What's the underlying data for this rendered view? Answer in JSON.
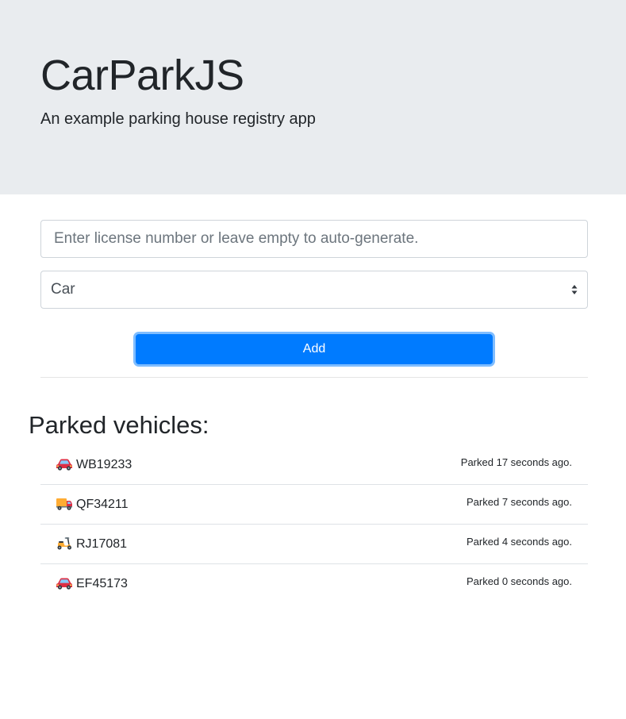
{
  "header": {
    "title": "CarParkJS",
    "subtitle": "An example parking house registry app"
  },
  "form": {
    "license_placeholder": "Enter license number or leave empty to auto-generate.",
    "license_value": "",
    "vehicle_type_selected": "Car",
    "add_label": "Add"
  },
  "list": {
    "heading": "Parked vehicles:",
    "items": [
      {
        "icon": "red-car-icon",
        "plate": "WB19233",
        "time": "Parked 17 seconds ago."
      },
      {
        "icon": "delivery-truck-icon",
        "plate": "QF34211",
        "time": "Parked 7 seconds ago."
      },
      {
        "icon": "motor-scooter-icon",
        "plate": "RJ17081",
        "time": "Parked 4 seconds ago."
      },
      {
        "icon": "red-car-icon",
        "plate": "EF45173",
        "time": "Parked 0 seconds ago."
      }
    ]
  },
  "colors": {
    "header_background": "#e9ecef",
    "primary": "#007bff",
    "text": "#212529",
    "border": "#ced4da"
  }
}
